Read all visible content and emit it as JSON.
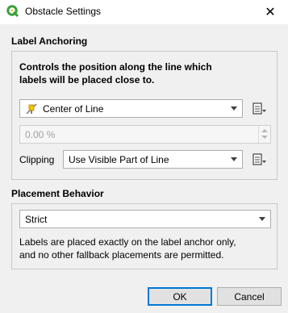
{
  "window": {
    "title": "Obstacle Settings",
    "close_glyph": "✕"
  },
  "label_anchoring": {
    "section_title": "Label Anchoring",
    "description_line1": "Controls the position along the line which",
    "description_line2": "labels will be placed close to.",
    "anchor_combo": {
      "value": "Center of Line",
      "icon": "center-of-line-icon"
    },
    "percent_spin": {
      "value": "0.00 %"
    },
    "clipping": {
      "label": "Clipping",
      "value": "Use Visible Part of Line"
    }
  },
  "placement_behavior": {
    "section_title": "Placement Behavior",
    "mode_combo": {
      "value": "Strict"
    },
    "description_line1": "Labels are placed exactly on the label anchor only,",
    "description_line2": "and no other fallback placements are permitted."
  },
  "buttons": {
    "ok": "OK",
    "cancel": "Cancel"
  },
  "colors": {
    "accent": "#0078d7",
    "qgis_green": "#3a9f3a"
  }
}
